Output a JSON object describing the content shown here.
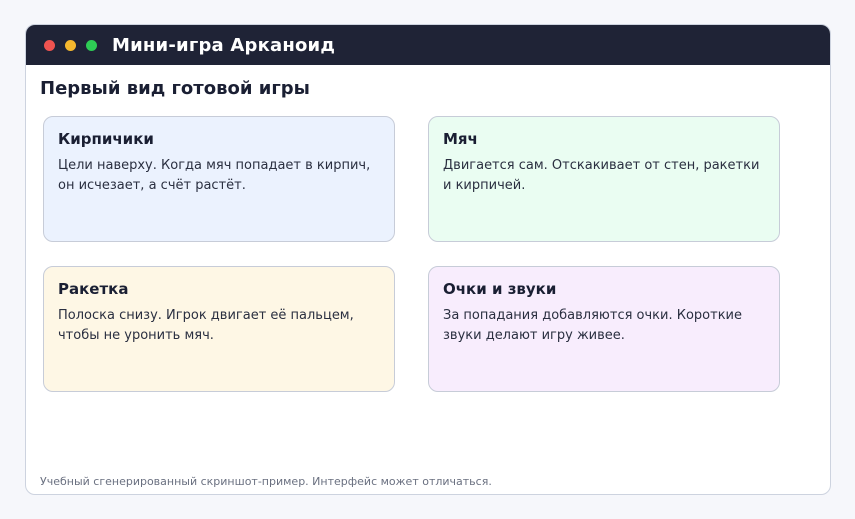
{
  "window": {
    "title": "Мини-игра Арканоид"
  },
  "main": {
    "heading": "Первый вид готовой игры",
    "cards": [
      {
        "title": "Кирпичики",
        "text": "Цели наверху. Когда мяч попадает в кирпич, он исчезает, а счёт растёт.",
        "bg": "#ebf2fe"
      },
      {
        "title": "Мяч",
        "text": "Двигается сам. Отскакивает от стен, ракетки и кирпичей.",
        "bg": "#eafdf2"
      },
      {
        "title": "Ракетка",
        "text": "Полоска снизу. Игрок двигает её пальцем, чтобы не уронить мяч.",
        "bg": "#fef7e5"
      },
      {
        "title": "Очки и звуки",
        "text": "За попадания добавляются очки. Короткие звуки делают игру живее.",
        "bg": "#f8edfd"
      }
    ]
  },
  "footer": {
    "note": "Учебный сгенерированный скриншот-пример. Интерфейс может отличаться."
  },
  "colors": {
    "titlebar": "#1f2336",
    "dot_close": "#ef5350",
    "dot_minimize": "#f5b82e",
    "dot_maximize": "#2ecc55"
  }
}
